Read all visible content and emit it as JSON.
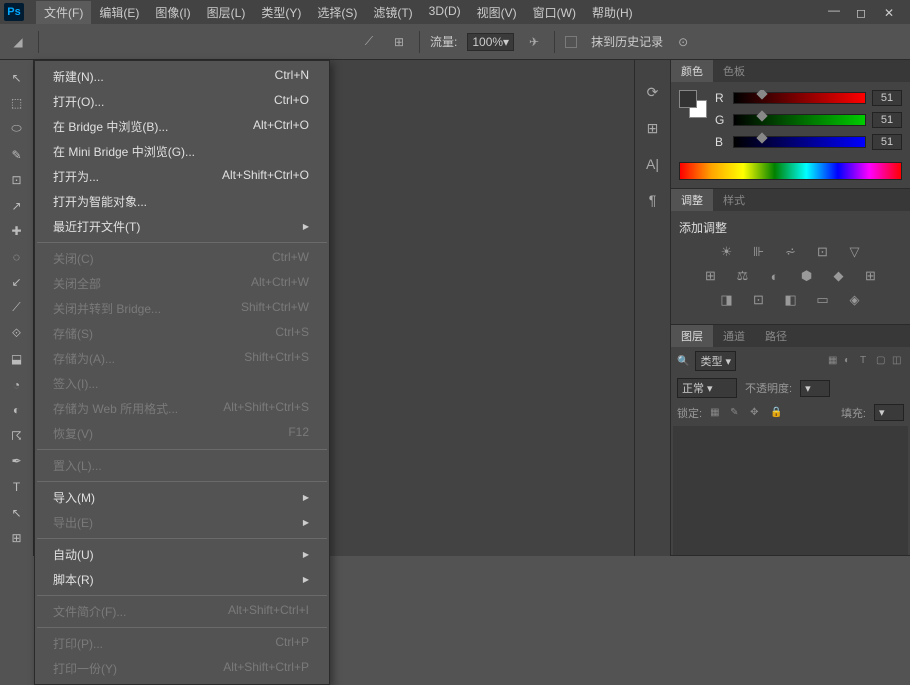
{
  "menubar": [
    "文件(F)",
    "编辑(E)",
    "图像(I)",
    "图层(L)",
    "类型(Y)",
    "选择(S)",
    "滤镜(T)",
    "3D(D)",
    "视图(V)",
    "窗口(W)",
    "帮助(H)"
  ],
  "active_menu_index": 0,
  "optbar": {
    "flow_label": "流量:",
    "flow_value": "100%",
    "erase_history": "抹到历史记录"
  },
  "dropdown": [
    {
      "label": "新建(N)...",
      "shortcut": "Ctrl+N"
    },
    {
      "label": "打开(O)...",
      "shortcut": "Ctrl+O"
    },
    {
      "label": "在 Bridge 中浏览(B)...",
      "shortcut": "Alt+Ctrl+O"
    },
    {
      "label": "在 Mini Bridge 中浏览(G)..."
    },
    {
      "label": "打开为...",
      "shortcut": "Alt+Shift+Ctrl+O"
    },
    {
      "label": "打开为智能对象..."
    },
    {
      "label": "最近打开文件(T)",
      "submenu": true
    },
    {
      "sep": true
    },
    {
      "label": "关闭(C)",
      "shortcut": "Ctrl+W",
      "disabled": true
    },
    {
      "label": "关闭全部",
      "shortcut": "Alt+Ctrl+W",
      "disabled": true
    },
    {
      "label": "关闭并转到 Bridge...",
      "shortcut": "Shift+Ctrl+W",
      "disabled": true
    },
    {
      "label": "存储(S)",
      "shortcut": "Ctrl+S",
      "disabled": true
    },
    {
      "label": "存储为(A)...",
      "shortcut": "Shift+Ctrl+S",
      "disabled": true
    },
    {
      "label": "签入(I)...",
      "disabled": true
    },
    {
      "label": "存储为 Web 所用格式...",
      "shortcut": "Alt+Shift+Ctrl+S",
      "disabled": true
    },
    {
      "label": "恢复(V)",
      "shortcut": "F12",
      "disabled": true
    },
    {
      "sep": true
    },
    {
      "label": "置入(L)...",
      "disabled": true
    },
    {
      "sep": true
    },
    {
      "label": "导入(M)",
      "submenu": true
    },
    {
      "label": "导出(E)",
      "submenu": true,
      "disabled": true
    },
    {
      "sep": true
    },
    {
      "label": "自动(U)",
      "submenu": true
    },
    {
      "label": "脚本(R)",
      "submenu": true
    },
    {
      "sep": true
    },
    {
      "label": "文件简介(F)...",
      "shortcut": "Alt+Shift+Ctrl+I",
      "disabled": true
    },
    {
      "sep": true
    },
    {
      "label": "打印(P)...",
      "shortcut": "Ctrl+P",
      "disabled": true
    },
    {
      "label": "打印一份(Y)",
      "shortcut": "Alt+Shift+Ctrl+P",
      "disabled": true
    }
  ],
  "panels": {
    "color": {
      "tab1": "颜色",
      "tab2": "色板",
      "r": "R",
      "g": "G",
      "b": "B",
      "val_r": "51",
      "val_g": "51",
      "val_b": "51"
    },
    "adjust": {
      "tab1": "调整",
      "tab2": "样式",
      "label": "添加调整"
    },
    "layers": {
      "tab1": "图层",
      "tab2": "通道",
      "tab3": "路径",
      "kind": "类型",
      "blend": "正常",
      "opacity_lbl": "不透明度:",
      "lock_lbl": "锁定:",
      "fill_lbl": "填充:"
    }
  },
  "tools": [
    "↖",
    "⬚",
    "⬭",
    "✎",
    "⊡",
    "↗",
    "✚",
    "◌",
    "↙",
    "⟋",
    "⟐",
    "⬓",
    "◔",
    "◐",
    "☈",
    "✒",
    "T",
    "↖",
    "⊞"
  ]
}
